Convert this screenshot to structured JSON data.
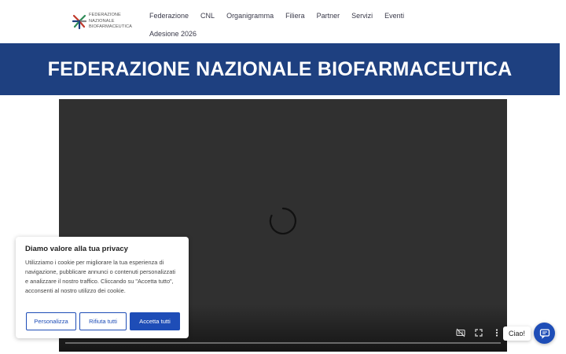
{
  "header": {
    "logo_lines": [
      "FEDERAZIONE",
      "NAZIONALE",
      "BIOFARMACEUTICA"
    ],
    "nav_row1": [
      "Federazione",
      "CNL",
      "Organigramma",
      "Filiera",
      "Partner",
      "Servizi",
      "Eventi"
    ],
    "nav_row2": [
      "Adesione 2026"
    ]
  },
  "banner": {
    "title": "FEDERAZIONE NAZIONALE BIOFARMACEUTICA"
  },
  "video": {
    "state": "loading",
    "controls": [
      "captions-icon",
      "fullscreen-icon",
      "more-icon"
    ]
  },
  "cookie": {
    "title": "Diamo valore alla tua privacy",
    "text": "Utilizziamo i cookie per migliorare la tua esperienza di navigazione, pubblicare annunci o contenuti personalizzati e analizzare il nostro traffico. Cliccando su \"Accetta tutto\", acconsenti al nostro utilizzo dei cookie.",
    "customize_label": "Personalizza",
    "reject_label": "Rifiuta tutti",
    "accept_label": "Accetta tutti"
  },
  "chat": {
    "label": "Ciao!"
  },
  "colors": {
    "brand_blue": "#1e4080",
    "button_blue": "#1e4db7",
    "video_bg": "#303030"
  }
}
